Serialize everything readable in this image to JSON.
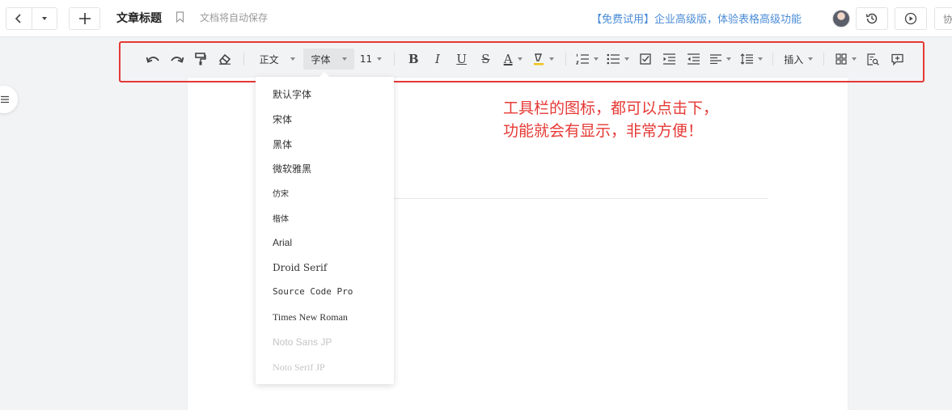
{
  "header": {
    "title": "文章标题",
    "autosave_text": "文档将自动保存",
    "promo_text": "【免费试用】企业高级版，体验表格高级功能",
    "collab_label": "协"
  },
  "toolbar": {
    "style_label": "正文",
    "font_label": "字体",
    "size_label": "11",
    "bold_label": "B",
    "italic_label": "I",
    "underline_label": "U",
    "strike_label": "S",
    "fontcolor_label": "A",
    "insert_label": "插入",
    "frame_color": "#e53935"
  },
  "font_menu": {
    "items": [
      {
        "label": "默认字体",
        "disabled": false
      },
      {
        "label": "宋体",
        "disabled": false
      },
      {
        "label": "黑体",
        "disabled": false
      },
      {
        "label": "微软雅黑",
        "disabled": false
      },
      {
        "label": "仿宋",
        "disabled": false
      },
      {
        "label": "楷体",
        "disabled": false
      },
      {
        "label": "Arial",
        "disabled": false
      },
      {
        "label": "Droid Serif",
        "disabled": false
      },
      {
        "label": "Source Code Pro",
        "disabled": false
      },
      {
        "label": "Times New Roman",
        "disabled": false
      },
      {
        "label": "Noto Sans JP",
        "disabled": true
      },
      {
        "label": "Noto Serif JP",
        "disabled": true
      }
    ]
  },
  "annotation": {
    "line1": "工具栏的图标，都可以点击下，",
    "line2": "功能就会有显示，非常方便！",
    "color": "#e53935"
  }
}
